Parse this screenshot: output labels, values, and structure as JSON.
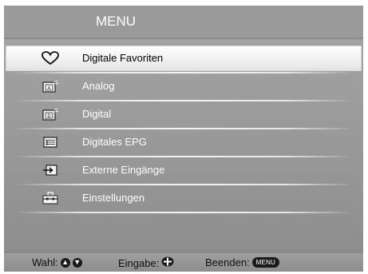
{
  "header": {
    "title": "MENU"
  },
  "menu": {
    "items": [
      {
        "label": "Digitale Favoriten",
        "icon": "heart-icon",
        "selected": true
      },
      {
        "label": "Analog",
        "icon": "analog-tv-icon",
        "selected": false,
        "icon_letter": "A"
      },
      {
        "label": "Digital",
        "icon": "digital-tv-icon",
        "selected": false,
        "icon_letter": "D"
      },
      {
        "label": "Digitales EPG",
        "icon": "epg-guide-icon",
        "selected": false
      },
      {
        "label": "Externe Eingänge",
        "icon": "external-input-icon",
        "selected": false
      },
      {
        "label": "Einstellungen",
        "icon": "settings-toolbox-icon",
        "selected": false
      }
    ]
  },
  "footer": {
    "select_label": "Wahl:",
    "enter_label": "Eingabe:",
    "exit_label": "Beenden:",
    "exit_key": "MENU"
  },
  "colors": {
    "background": "#8c8c8c",
    "selected_bg": "#f2f2f2",
    "text_normal": "#ffffff",
    "text_selected": "#000000"
  }
}
